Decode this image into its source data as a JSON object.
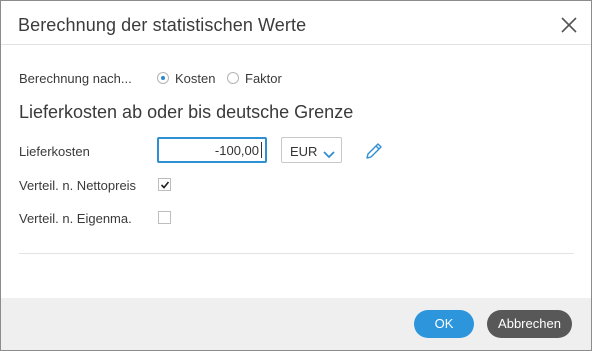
{
  "dialog": {
    "title": "Berechnung der statistischen Werte"
  },
  "calculation": {
    "label": "Berechnung nach...",
    "options": [
      {
        "label": "Kosten",
        "checked": true
      },
      {
        "label": "Faktor",
        "checked": false
      }
    ]
  },
  "section": {
    "heading": "Lieferkosten ab oder bis deutsche Grenze"
  },
  "delivery_costs": {
    "label": "Lieferkosten",
    "value": "-100,00",
    "currency": "EUR"
  },
  "net_price_distribution": {
    "label": "Verteil. n. Nettopreis",
    "checked": true
  },
  "own_distribution": {
    "label": "Verteil. n. Eigenma.",
    "checked": false
  },
  "footer": {
    "ok_label": "OK",
    "cancel_label": "Abbrechen"
  },
  "colors": {
    "accent": "#2c95dc",
    "cancel_button": "#585858",
    "footer_bg": "#efefef"
  },
  "icons": {
    "close": "close-icon",
    "chevron": "chevron-down-icon",
    "edit": "pencil-icon",
    "check": "checkmark-icon"
  }
}
